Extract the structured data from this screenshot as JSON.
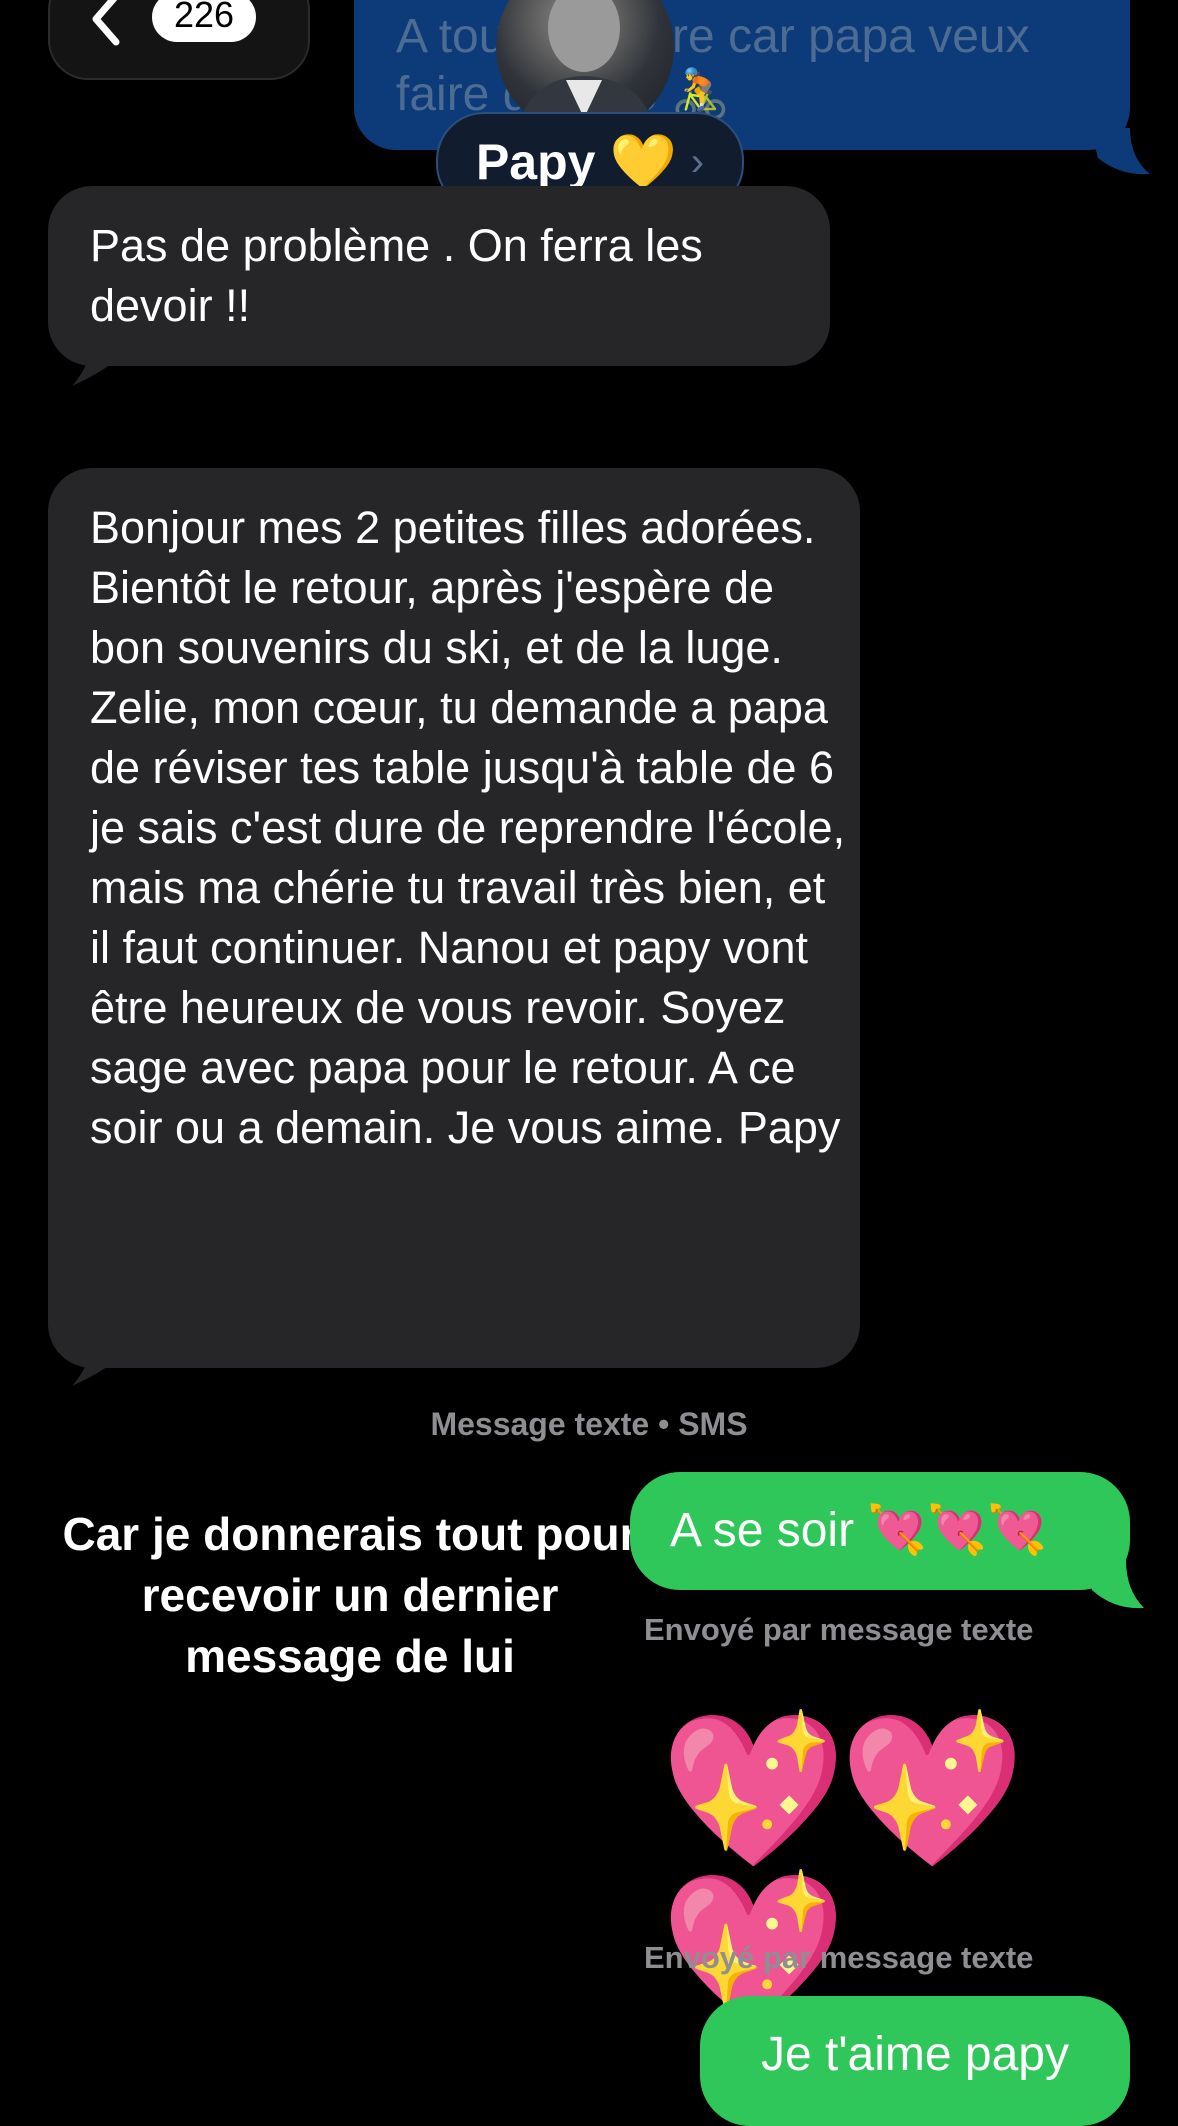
{
  "nav": {
    "unread_count": "226",
    "back_icon": "chevron-left-icon"
  },
  "top_message": {
    "text": "A tout à l'heure car papa veux faire du vélo 🚴"
  },
  "contact": {
    "name": "Papy",
    "heart": "💛",
    "avatar_icon": "contact-avatar-photo"
  },
  "messages_received": [
    {
      "text": "Pas de problème . On ferra les devoir !!"
    },
    {
      "text": "Bonjour mes 2 petites filles adorées. Bientôt le retour, après j'espère de bon souvenirs du ski, et de la luge. Zelie, mon cœur, tu demande a papa de réviser tes table jusqu'à table de 6 je sais c'est dure de reprendre l'école, mais ma chérie tu travail très bien, et il faut continuer. Nanou et papy vont être heureux de vous revoir. Soyez sage avec papa pour le retour. A ce soir ou a demain. Je vous aime. Papy"
    }
  ],
  "service_label": "Message texte • SMS",
  "overlay_caption": "Car je donnerais tout pour recevoir un dernier message de lui",
  "messages_sent": [
    {
      "text": "A se soir",
      "emojis": " 💘💘💘"
    },
    {
      "text": "💖💖💖"
    },
    {
      "text": "Je t'aime papy"
    }
  ],
  "delivered_label": "Envoyé par message texte",
  "colors": {
    "background": "#000000",
    "received_bubble": "#262628",
    "sent_bubble": "#30c75a",
    "imessage_bubble": "#0d3a78",
    "meta_text": "#8e8e93"
  }
}
